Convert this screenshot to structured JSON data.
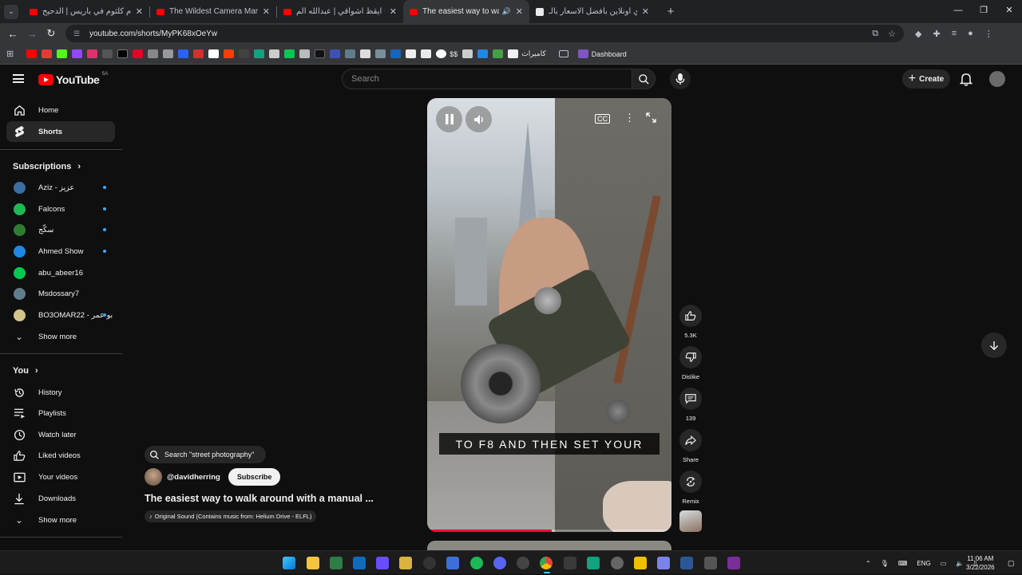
{
  "browser": {
    "tabs": [
      {
        "title": "أم كلثوم في باريس | الدحيح - be",
        "active": false,
        "audio": false
      },
      {
        "title": "The Wildest Camera Market I've",
        "active": false,
        "audio": false
      },
      {
        "title": "يا حلماً أيقظ أشواقي | عبدالله الم",
        "active": false,
        "audio": false
      },
      {
        "title": "The easiest way to walk aro",
        "active": true,
        "audio": true
      },
      {
        "title": "اشتري اونلاين بأفضل الاسعار بالـ",
        "active": false,
        "audio": false
      }
    ],
    "url": "youtube.com/shorts/MyPK68xOeYw",
    "bookmarks": {
      "folder1": "كاميرات",
      "dollar": "$$",
      "dashboard": "Dashboard"
    }
  },
  "youtube": {
    "logo_text": "YouTube",
    "country": "SA",
    "search_placeholder": "Search",
    "create_label": "Create"
  },
  "sidebar": {
    "main": [
      {
        "label": "Home",
        "icon": "home-icon"
      },
      {
        "label": "Shorts",
        "icon": "shorts-icon",
        "active": true
      }
    ],
    "subscriptions_title": "Subscriptions",
    "subscriptions": [
      {
        "label": "Aziz - عزيز",
        "new": true,
        "color": "#3a6ea5"
      },
      {
        "label": "Falcons",
        "new": true,
        "color": "#1db954"
      },
      {
        "label": "سكّج",
        "new": true,
        "color": "#2e7d32"
      },
      {
        "label": "Ahmed Show",
        "new": true,
        "color": "#1e88e5"
      },
      {
        "label": "abu_abeer16",
        "new": false,
        "color": "#00c853"
      },
      {
        "label": "Msdossary7",
        "new": false,
        "color": "#607d8b"
      },
      {
        "label": "BO3OMAR22 - بو عمر",
        "new": true,
        "color": "#d4c48a"
      }
    ],
    "show_more": "Show more",
    "you_title": "You",
    "you_items": [
      {
        "label": "History",
        "icon": "history-icon"
      },
      {
        "label": "Playlists",
        "icon": "playlists-icon"
      },
      {
        "label": "Watch later",
        "icon": "watch-later-icon"
      },
      {
        "label": "Liked videos",
        "icon": "liked-icon"
      },
      {
        "label": "Your videos",
        "icon": "your-videos-icon"
      },
      {
        "label": "Downloads",
        "icon": "downloads-icon"
      }
    ],
    "show_more_2": "Show more"
  },
  "short": {
    "caption": "TO F8 AND THEN SET YOUR",
    "progress": 0.51,
    "search_chip": "Search \"street photography\"",
    "channel": "@davidherring",
    "subscribe_label": "Subscribe",
    "title": "The easiest way to walk around with a manual ...",
    "sound": "Original Sound (Contains music from: Helium Drive - ELFL)",
    "actions": {
      "likes": "5.3K",
      "dislike": "Dislike",
      "comments": "139",
      "share": "Share",
      "remix": "Remix"
    }
  },
  "taskbar": {
    "lang": "ENG",
    "time": "11:06 AM",
    "date": "3/22/2026"
  }
}
